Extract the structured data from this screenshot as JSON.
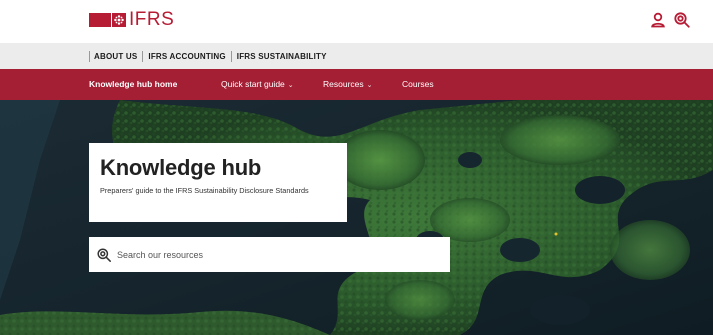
{
  "brand": {
    "name": "IFRS",
    "accent": "#b71c35",
    "nav_color": "#a41e34"
  },
  "header": {
    "icons": [
      "user-icon",
      "search-icon"
    ]
  },
  "topnav": {
    "items": [
      "ABOUT US",
      "IFRS ACCOUNTING",
      "IFRS SUSTAINABILITY"
    ]
  },
  "mainnav": {
    "home": "Knowledge hub home",
    "quick_start": "Quick start guide",
    "resources": "Resources",
    "courses": "Courses",
    "chevron": "⌄"
  },
  "hero": {
    "title": "Knowledge hub",
    "subtitle": "Preparers' guide to the IFRS Sustainability Disclosure Standards",
    "search_placeholder": "Search our resources"
  }
}
